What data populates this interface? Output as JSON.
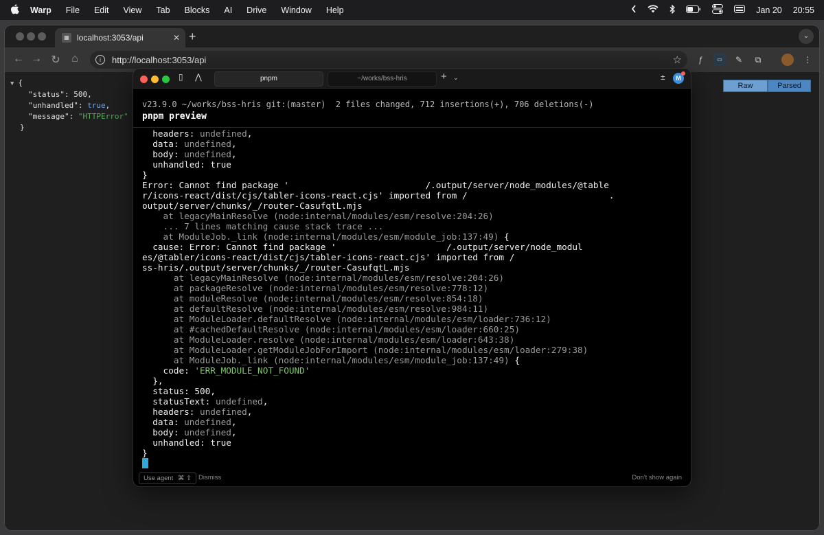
{
  "menubar": {
    "app": "Warp",
    "items": [
      "File",
      "Edit",
      "View",
      "Tab",
      "Blocks",
      "AI",
      "Drive",
      "Window",
      "Help"
    ],
    "date": "Jan 20",
    "time": "20:55"
  },
  "browser": {
    "tab_title": "localhost:3053/api",
    "url": "http://localhost:3053/api",
    "view_toggle": {
      "raw": "Raw",
      "parsed": "Parsed"
    }
  },
  "json_view": {
    "open_brace": "{",
    "close_brace": "}",
    "fields": [
      {
        "key": "\"status\"",
        "value": "500",
        "type": "num",
        "comma": ","
      },
      {
        "key": "\"unhandled\"",
        "value": "true",
        "type": "bool",
        "comma": ","
      },
      {
        "key": "\"message\"",
        "value": "\"HTTPError\"",
        "type": "str",
        "comma": ""
      }
    ]
  },
  "warp": {
    "tabs": [
      "pnpm",
      "~/works/bss-hris"
    ],
    "avatar": "M",
    "prompt_info": "v23.9.0 ~/works/bss-hris git:(master)  2 files changed, 712 insertions(+), 706 deletions(-)",
    "command": "pnpm preview",
    "output_lines": [
      [
        {
          "t": "  headers: "
        },
        {
          "t": "undefined",
          "c": "dim"
        },
        {
          "t": ","
        }
      ],
      [
        {
          "t": "  data: "
        },
        {
          "t": "undefined",
          "c": "dim"
        },
        {
          "t": ","
        }
      ],
      [
        {
          "t": "  body: "
        },
        {
          "t": "undefined",
          "c": "dim"
        },
        {
          "t": ","
        }
      ],
      [
        {
          "t": "  unhandled: "
        },
        {
          "t": "true"
        }
      ],
      [
        {
          "t": "}"
        }
      ],
      [
        {
          "t": "Error: Cannot find package '                          /.output/server/node_modules/@table"
        }
      ],
      [
        {
          "t": "r/icons-react/dist/cjs/tabler-icons-react.cjs' imported from /                           ."
        }
      ],
      [
        {
          "t": "output/server/chunks/_/router-CasufqtL.mjs"
        }
      ],
      [
        {
          "t": "    at legacyMainResolve (node:internal/modules/esm/resolve:204:26)",
          "c": "dim"
        }
      ],
      [
        {
          "t": "    ... 7 lines matching cause stack trace ...",
          "c": "dim"
        }
      ],
      [
        {
          "t": "    at ModuleJob._link (node:internal/modules/esm/module_job:137:49)",
          "c": "dim"
        },
        {
          "t": " {"
        }
      ],
      [
        {
          "t": "  cause: Error: Cannot find package '                     /.output/server/node_modul"
        }
      ],
      [
        {
          "t": "es/@tabler/icons-react/dist/cjs/tabler-icons-react.cjs' imported from /"
        }
      ],
      [
        {
          "t": "ss-hris/.output/server/chunks/_/router-CasufqtL.mjs"
        }
      ],
      [
        {
          "t": "      at legacyMainResolve (node:internal/modules/esm/resolve:204:26)",
          "c": "dim"
        }
      ],
      [
        {
          "t": "      at packageResolve (node:internal/modules/esm/resolve:778:12)",
          "c": "dim"
        }
      ],
      [
        {
          "t": "      at moduleResolve (node:internal/modules/esm/resolve:854:18)",
          "c": "dim"
        }
      ],
      [
        {
          "t": "      at defaultResolve (node:internal/modules/esm/resolve:984:11)",
          "c": "dim"
        }
      ],
      [
        {
          "t": "      at ModuleLoader.defaultResolve (node:internal/modules/esm/loader:736:12)",
          "c": "dim"
        }
      ],
      [
        {
          "t": "      at #cachedDefaultResolve (node:internal/modules/esm/loader:660:25)",
          "c": "dim"
        }
      ],
      [
        {
          "t": "      at ModuleLoader.resolve (node:internal/modules/esm/loader:643:38)",
          "c": "dim"
        }
      ],
      [
        {
          "t": "      at ModuleLoader.getModuleJobForImport (node:internal/modules/esm/loader:279:38)",
          "c": "dim"
        }
      ],
      [
        {
          "t": "      at ModuleJob._link (node:internal/modules/esm/module_job:137:49)",
          "c": "dim"
        },
        {
          "t": " {"
        }
      ],
      [
        {
          "t": "    code: "
        },
        {
          "t": "'ERR_MODULE_NOT_FOUND'",
          "c": "green"
        }
      ],
      [
        {
          "t": "  },"
        }
      ],
      [
        {
          "t": "  status: "
        },
        {
          "t": "500"
        },
        {
          "t": ","
        }
      ],
      [
        {
          "t": "  statusText: "
        },
        {
          "t": "undefined",
          "c": "dim"
        },
        {
          "t": ","
        }
      ],
      [
        {
          "t": "  headers: "
        },
        {
          "t": "undefined",
          "c": "dim"
        },
        {
          "t": ","
        }
      ],
      [
        {
          "t": "  data: "
        },
        {
          "t": "undefined",
          "c": "dim"
        },
        {
          "t": ","
        }
      ],
      [
        {
          "t": "  body: "
        },
        {
          "t": "undefined",
          "c": "dim"
        },
        {
          "t": ","
        }
      ],
      [
        {
          "t": "  unhandled: "
        },
        {
          "t": "true"
        }
      ],
      [
        {
          "t": "}"
        }
      ]
    ],
    "footer": {
      "use_agent": "Use agent",
      "use_agent_shortcut": "⌘ ⇧",
      "dismiss": "Dismiss",
      "dont_show": "Don't show again"
    }
  },
  "colors": {
    "accent": "#2da8d8",
    "json_bool": "#6ba4ff",
    "json_string": "#4fb25a",
    "error_code": "#7ec86a"
  }
}
